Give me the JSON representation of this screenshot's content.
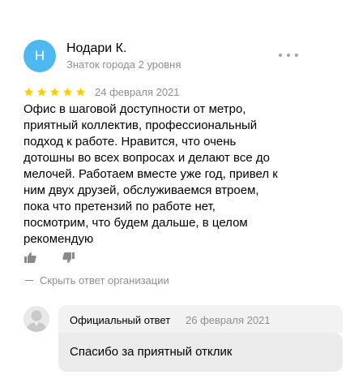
{
  "review": {
    "author": {
      "initial": "Н",
      "name": "Нодари К.",
      "status": "Знаток города 2 уровня",
      "avatar_color": "#4db8f2"
    },
    "rating": 5,
    "max_rating": 5,
    "date": "24 февраля 2021",
    "text_lines": [
      "Офис в шаговой доступности от метро,",
      "приятный коллектив, профессиональный",
      "подход к работе. Нравится, что очень",
      "дотошны во всех вопросах и делают все до",
      "мелочей. Работаем вместе уже год, привел к",
      "ним двух друзей, обслуживаемся втроем,",
      "пока что претензий по работе нет,",
      "посмотрим, что будем дальше, в целом",
      "рекомендую"
    ],
    "icons": {
      "more": "more-dots-icon",
      "like": "thumbs-up-icon",
      "dislike": "thumbs-down-icon",
      "star": "star-icon"
    },
    "star_color": "#fc0"
  },
  "hide_answer_label": "Скрыть ответ организации",
  "official_reply": {
    "label": "Официальный ответ",
    "date": "26 февраля 2021",
    "text": "Спасибо за приятный отклик",
    "avatar_icon": "organization-avatar-icon"
  }
}
